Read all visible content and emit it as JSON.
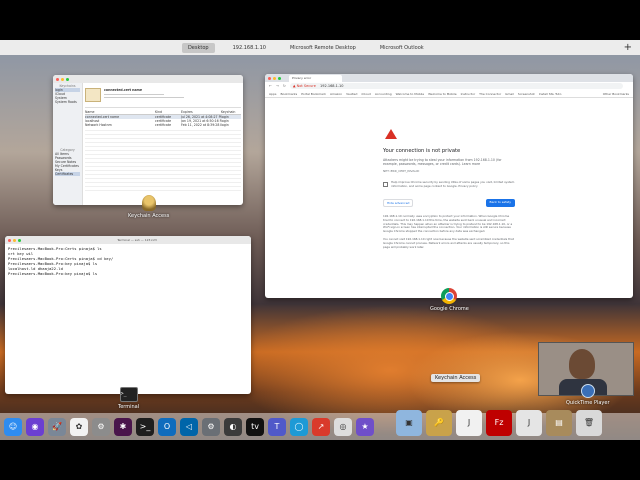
{
  "spaces": [
    "Desktop",
    "192.168.1.10",
    "Microsoft Remote Desktop",
    "Microsoft Outlook"
  ],
  "add_space": "+",
  "keychain": {
    "sidebar_header": "Keychains",
    "keychains": [
      "login",
      "iCloud",
      "System",
      "System Roots"
    ],
    "category_header": "Category",
    "categories": [
      "All Items",
      "Passwords",
      "Secure Notes",
      "My Certificates",
      "Keys",
      "Certificates"
    ],
    "cert_name": "connected.cert name",
    "columns": [
      "Name",
      "Kind",
      "Expires",
      "Keychain"
    ],
    "rows": [
      [
        "connected.cert name",
        "certificate",
        "Jul 26, 2021 at 4:08:27 PM",
        "login"
      ],
      [
        "localhost",
        "certificate",
        "Jan 19, 2021 at 6:50:16 PM",
        "login"
      ],
      [
        "Network Hostnm",
        "certificate",
        "Feb 11, 2022 at 8:39:28 PM",
        "login"
      ]
    ]
  },
  "terminal": {
    "title": "Terminal — ssh — 123×23",
    "lines": [
      "Precilesaers-MacBook-Pro:Certs pinaja$ ls",
      "crt      key      wil",
      "Precilesaers-MacBook-Pro:Certs pinaja$ cd key/",
      "Precilesaers-MacBook-Pro:key pinaja$ ls",
      "localhost.ld    dhaaja22.ld",
      "Precilesaers-MacBook-Pro:key pinaja$ ls"
    ]
  },
  "chrome": {
    "tab_title": "Privacy error",
    "url_warning": "Not Secure",
    "url": "192.168.1.10",
    "bookmarks": [
      "Apps",
      "Bookmarks",
      "Portal Bookmark",
      "Amazon",
      "Vaulted",
      "iCloud",
      "Accounting",
      "Welcome to Mobile",
      "Welcome to Mobile",
      "Instructor",
      "The Connector",
      "Gmail",
      "Screenshot",
      "Install SSL Tuto"
    ],
    "other_bookmarks": "Other Bookmarks",
    "heading": "Your connection is not private",
    "body": "Attackers might be trying to steal your information from 192.168.1.10 (for example, passwords, messages, or credit cards). Learn more",
    "error_code": "NET::ERR_CERT_INVALID",
    "checkbox_text": "Help improve Chrome security by sending URLs of some pages you visit, limited system information, and some page content to Google. Privacy policy",
    "hide_button": "Hide advanced",
    "back_button": "Back to safety",
    "adv1": "192.168.1.10 normally uses encryption to protect your information. When Google Chrome tried to connect to 192.168.1.10 this time, the website sent back unusual and incorrect credentials. This may happen when an attacker is trying to pretend to be 192.168.1.10, or a Wi-Fi sign-in screen has interrupted the connection. Your information is still secure because Google Chrome stopped the connection before any data was exchanged.",
    "adv2": "You cannot visit 192.168.1.10 right now because the website sent scrambled credentials that Google Chrome cannot process. Network errors and attacks are usually temporary, so this page will probably work later."
  },
  "desktop_icons": {
    "keychain": "Keychain Access",
    "chrome": "Google Chrome",
    "terminal": "Terminal",
    "quicktime": "QuickTime Player"
  },
  "dock": {
    "tooltip": "Keychain Access",
    "apps": [
      {
        "name": "finder",
        "glyph": "☺",
        "color": "#2e8cf0"
      },
      {
        "name": "siri",
        "glyph": "◉",
        "color": "#6b3fd1"
      },
      {
        "name": "launchpad",
        "glyph": "🚀",
        "color": "#7a8797"
      },
      {
        "name": "photos",
        "glyph": "✿",
        "color": "#f2f2f2"
      },
      {
        "name": "preferences",
        "glyph": "⚙",
        "color": "#8c8c8c"
      },
      {
        "name": "slack",
        "glyph": "✱",
        "color": "#4a154b"
      },
      {
        "name": "terminal",
        "glyph": ">_",
        "color": "#1e1e1e"
      },
      {
        "name": "outlook",
        "glyph": "O",
        "color": "#0f6cbd"
      },
      {
        "name": "vscode",
        "glyph": "◁",
        "color": "#0065a9"
      },
      {
        "name": "settings",
        "glyph": "⚙",
        "color": "#6a6f75"
      },
      {
        "name": "browser",
        "glyph": "◐",
        "color": "#3b3b3b"
      },
      {
        "name": "apple-tv",
        "glyph": "tv",
        "color": "#111111"
      },
      {
        "name": "teams",
        "glyph": "T",
        "color": "#5059c9"
      },
      {
        "name": "edge",
        "glyph": "◯",
        "color": "#1d9ad6"
      },
      {
        "name": "remote-desktop",
        "glyph": "↗",
        "color": "#d93a2b"
      },
      {
        "name": "chrome",
        "glyph": "◎",
        "color": "#dddddd"
      },
      {
        "name": "imovie",
        "glyph": "★",
        "color": "#6f4fc9"
      },
      {
        "name": "preview",
        "glyph": "▣",
        "color": "#8fb6de"
      },
      {
        "name": "keychain",
        "glyph": "🔑",
        "color": "#c9a24a"
      },
      {
        "name": "java",
        "glyph": "J",
        "color": "#f1f1f1"
      },
      {
        "name": "filezilla",
        "glyph": "Fz",
        "color": "#bf0000"
      },
      {
        "name": "java-2",
        "glyph": "J",
        "color": "#e5e5e5"
      },
      {
        "name": "archive",
        "glyph": "▤",
        "color": "#a88b5c"
      },
      {
        "name": "trash",
        "glyph": "🗑",
        "color": "#d9d9d9"
      }
    ]
  }
}
